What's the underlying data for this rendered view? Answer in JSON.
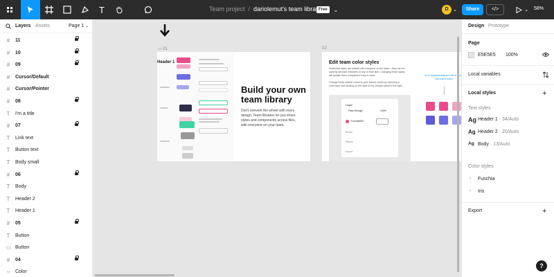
{
  "topbar": {
    "project": "Team project",
    "separator": "/",
    "file_name": "dariolemut's team library",
    "plan_badge": "Free",
    "avatar_initial": "D",
    "share_label": "Share",
    "zoom": "58%",
    "tool_icons": [
      "figma-menu-icon",
      "move-tool-icon",
      "frame-tool-icon",
      "shape-tool-icon",
      "pen-tool-icon",
      "text-tool-icon",
      "hand-tool-icon",
      "comment-tool-icon"
    ]
  },
  "left_panel": {
    "tabs": {
      "layers": "Layers",
      "assets": "Assets"
    },
    "page_selector": "Page 1",
    "layers": [
      {
        "icon": "#",
        "name": "11",
        "bold": true,
        "locked": true
      },
      {
        "icon": "#",
        "name": "10",
        "bold": true,
        "locked": true
      },
      {
        "icon": "#",
        "name": "09",
        "bold": true,
        "locked": true
      },
      {
        "icon": "#",
        "name": "Cursor/Default",
        "bold": true,
        "locked": false
      },
      {
        "icon": "#",
        "name": "Cursor/Pointer",
        "bold": true,
        "locked": false
      },
      {
        "icon": "#",
        "name": "08",
        "bold": true,
        "locked": true
      },
      {
        "icon": "T",
        "name": "I'm a title",
        "bold": false,
        "locked": false
      },
      {
        "icon": "#",
        "name": "07",
        "bold": true,
        "locked": true
      },
      {
        "icon": "T",
        "name": "Link text",
        "bold": false,
        "locked": false
      },
      {
        "icon": "T",
        "name": "Button text",
        "bold": false,
        "locked": false
      },
      {
        "icon": "T",
        "name": "Body small",
        "bold": false,
        "locked": false
      },
      {
        "icon": "#",
        "name": "06",
        "bold": true,
        "locked": true
      },
      {
        "icon": "T",
        "name": "Body",
        "bold": false,
        "locked": false
      },
      {
        "icon": "T",
        "name": "Header 2",
        "bold": false,
        "locked": false
      },
      {
        "icon": "T",
        "name": "Header 1",
        "bold": false,
        "locked": false
      },
      {
        "icon": "#",
        "name": "05",
        "bold": true,
        "locked": true
      },
      {
        "icon": "T",
        "name": "Button",
        "bold": false,
        "locked": false
      },
      {
        "icon": "▭",
        "name": "Button",
        "bold": false,
        "locked": false
      },
      {
        "icon": "#",
        "name": "04",
        "bold": true,
        "locked": true
      },
      {
        "icon": "○",
        "name": "Color",
        "bold": false,
        "locked": false
      }
    ]
  },
  "canvas": {
    "frame1": {
      "label": "01",
      "sidebar_header": "Header 1",
      "headline": "Build your own team library",
      "body": "Don't reinvent the wheel with every design. Team libraries let you share styles and components across files, with everyone on your team."
    },
    "frame2": {
      "label": "02",
      "title": "Edit team color styles",
      "body1": "Published styles are shared with everyone on the team—they can be used by all team members in any of their files. Changing these styles will update them everywhere they're used.",
      "body2": "Change these default colors to your team's colors by selecting a color layer and clicking on the style in the Design panel to the right.",
      "mock_layer_label": "Layer",
      "mock_pass_through": "Pass through",
      "mock_opacity": "100%",
      "mock_fill_name": "Fuschia500",
      "mock_rows": [
        "Stroke",
        "Effects",
        "Export"
      ],
      "hint": "Go to published abstract. Edit us to see your team's colors",
      "swatch_colors": [
        "#e84b8a",
        "#e84b8a",
        "#f0a3c1",
        "#5b5bd6",
        "#6e6ee0",
        "#a6a6ef"
      ]
    }
  },
  "right_panel": {
    "tabs": {
      "design": "Design",
      "prototype": "Prototype"
    },
    "page_section": "Page",
    "page_color_hex": "E5E5E5",
    "page_color_swatch": "#e5e5e5",
    "page_opacity": "100%",
    "local_variables": "Local variables",
    "local_styles": "Local styles",
    "text_styles_label": "Text styles",
    "text_styles": [
      {
        "glyph": "Ag",
        "name": "Header 1",
        "spec": "34/Auto"
      },
      {
        "glyph": "Ag",
        "name": "Header 2",
        "spec": "20/Auto"
      },
      {
        "glyph": "Ag",
        "name": "Body",
        "spec": "13/Auto"
      }
    ],
    "color_styles_label": "Color styles",
    "color_styles": [
      {
        "name": "Fuschia"
      },
      {
        "name": "Iris"
      }
    ],
    "export_label": "Export"
  },
  "help_label": "?",
  "colors": {
    "accent": "#0d99ff",
    "topbar": "#2c2c2c",
    "canvas": "#e5e5e5"
  }
}
